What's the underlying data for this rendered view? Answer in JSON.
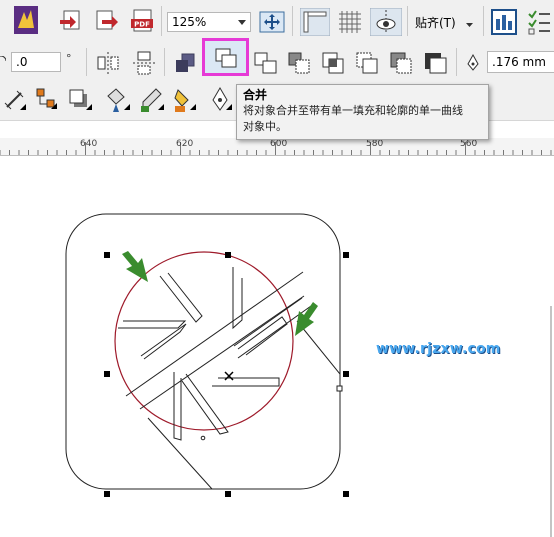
{
  "toolbar1": {
    "zoom_value": "125%",
    "snap_label": "贴齐(T)",
    "pdf_label": "PDF"
  },
  "toolbar2": {
    "angle_value": ".0",
    "degree_symbol": "°",
    "outline_width": ".176 mm"
  },
  "tooltip": {
    "title": "合并",
    "description_line1": "将对象合并至带有单一填充和轮廓的单一曲线",
    "description_line2": "对象中。"
  },
  "ruler": {
    "labels": [
      "640",
      "620",
      "600",
      "580",
      "560"
    ]
  },
  "watermark": "www.rjzxw.com",
  "colors": {
    "highlight_box": "#e63ad6",
    "circle_stroke": "#9e1a2a",
    "arrow_green": "#3a8c2e",
    "watermark": "#4aa8ef"
  }
}
